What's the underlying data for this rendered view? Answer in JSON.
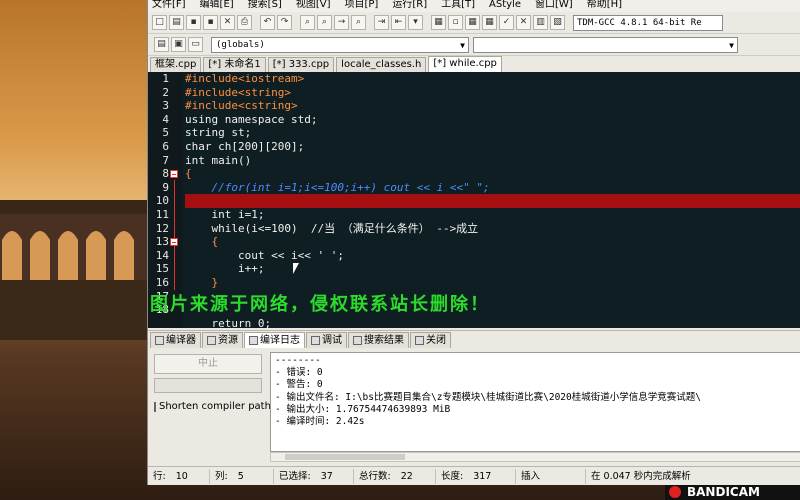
{
  "menu": [
    "文件[F]",
    "编辑[E]",
    "搜索[S]",
    "视图[V]",
    "项目[P]",
    "运行[R]",
    "工具[T]",
    "AStyle",
    "窗口[W]",
    "帮助[H]"
  ],
  "toolbar": {
    "compiler": "TDM-GCC 4.8.1 64-bit Re"
  },
  "toolbar2": {
    "scope": "(globals)",
    "function": ""
  },
  "tabs": [
    "框架.cpp",
    "[*] 未命名1",
    "[*] 333.cpp",
    "locale_classes.h",
    "[*] while.cpp"
  ],
  "code_lines": [
    "#include<iostream>",
    "#include<string>",
    "#include<cstring>",
    "using namespace std;",
    "string st;",
    "char ch[200][200];",
    "int main()",
    "{",
    "    //for(int i=1;i<=100;i++) cout << i <<\" \";",
    "    ",
    "    int i=1;",
    "    while(i<=100)  //当 （满足什么条件） -->成立",
    "    {",
    "        cout << i<< ' ';",
    "        i++;",
    "    }",
    "",
    "",
    "    return 0;"
  ],
  "line_numbers": [
    "1",
    "2",
    "3",
    "4",
    "5",
    "6",
    "7",
    "8",
    "9",
    "10",
    "11",
    "12",
    "13",
    "14",
    "15",
    "16",
    "17",
    "18"
  ],
  "watermark": "图片来源于网络，侵权联系站长删除！",
  "bottom_tabs": [
    "编译器",
    "资源",
    "编译日志",
    "调试",
    "搜索结果",
    "关闭"
  ],
  "panel": {
    "stop_label": "中止",
    "checkbox_label": "Shorten compiler paths",
    "log": [
      "--------",
      "- 错误: 0",
      "- 警告: 0",
      "- 输出文件名: I:\\bs比赛题目集合\\z专题模块\\桂城街道比赛\\2020桂城街道小学信息学竞赛试题\\",
      "- 输出大小: 1.76754474639893 MiB",
      "- 编译时间: 2.42s"
    ]
  },
  "status": {
    "row_label": "行:",
    "row": "10",
    "col_label": "列:",
    "col": "5",
    "sel_label": "已选择:",
    "sel": "37",
    "total_label": "总行数:",
    "total": "22",
    "len_label": "长度:",
    "len": "317",
    "mode": "插入",
    "parse": "在 0.047 秒内完成解析"
  },
  "recorder": "BANDICAM"
}
